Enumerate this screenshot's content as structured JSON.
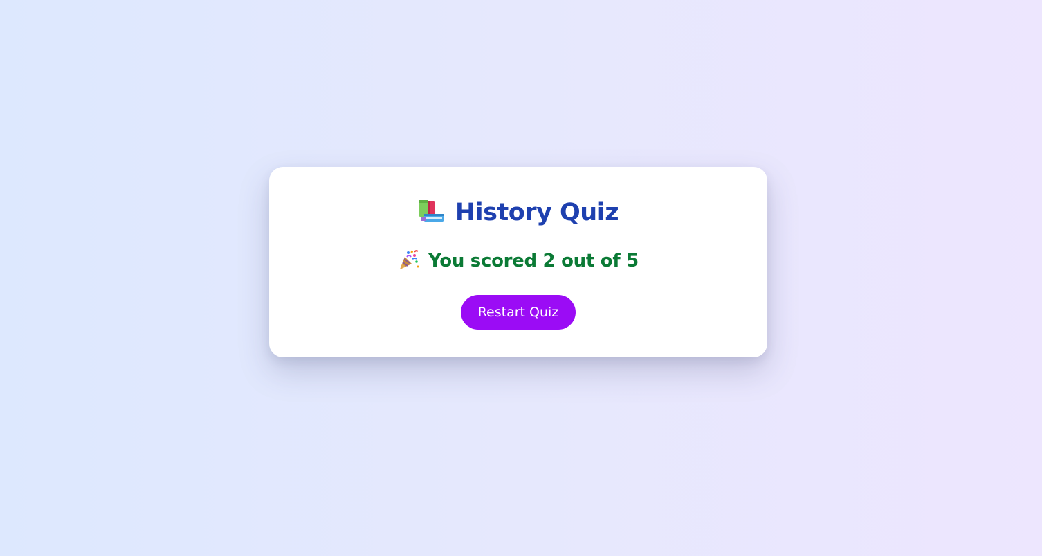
{
  "quiz": {
    "title": "History Quiz",
    "title_icon": "books-icon",
    "score_text": "You scored 2 out of 5",
    "score_icon": "party-popper-icon",
    "score": 2,
    "total": 5,
    "restart_label": "Restart Quiz"
  },
  "colors": {
    "title": "#1e40af",
    "score": "#0b7a35",
    "button": "#9b0cf5",
    "card": "#ffffff"
  }
}
